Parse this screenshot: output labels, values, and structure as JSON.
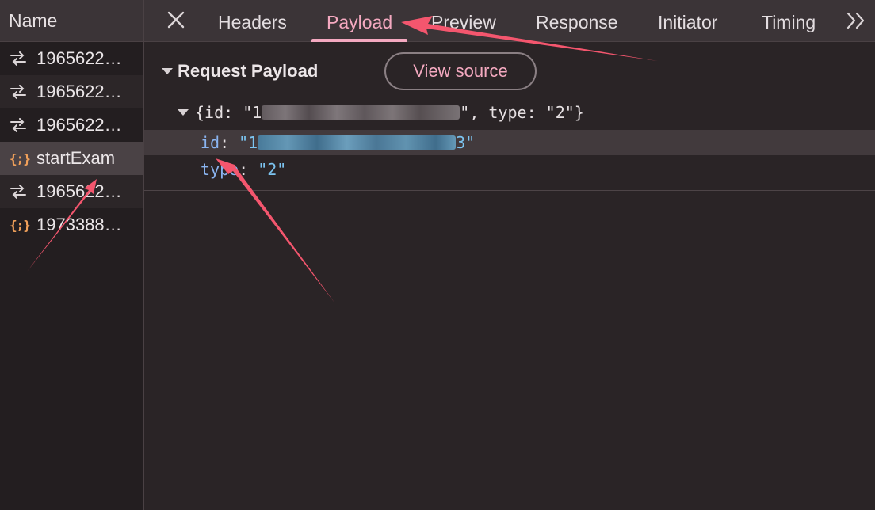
{
  "requests": {
    "header": "Name",
    "items": [
      {
        "label": "1965622…",
        "type": "xhr-icon"
      },
      {
        "label": "1965622…",
        "type": "xhr-icon"
      },
      {
        "label": "1965622…",
        "type": "xhr-icon"
      },
      {
        "label": "startExam",
        "type": "json-icon"
      },
      {
        "label": "1965622…",
        "type": "xhr-icon"
      },
      {
        "label": "1973388…",
        "type": "json-icon"
      }
    ],
    "json_glyph": "{;}"
  },
  "tabs": {
    "items": [
      "Headers",
      "Payload",
      "Preview",
      "Response",
      "Initiator",
      "Timing"
    ],
    "active": "Payload"
  },
  "payload": {
    "title": "Request Payload",
    "view_source": "View source",
    "summary": {
      "open": "{id: \"1",
      "close": "\", type: \"2\"}"
    },
    "props": [
      {
        "key": "id",
        "value_prefix": "\"1",
        "value_suffix": "3\"",
        "value_blurred": true
      },
      {
        "key": "type",
        "value": "\"2\""
      }
    ]
  },
  "colors": {
    "accent": "#f4a9c0",
    "annotation_arrow": "#f4566e",
    "json_key": "#8ab4f0",
    "json_string": "#7cc4f0"
  }
}
